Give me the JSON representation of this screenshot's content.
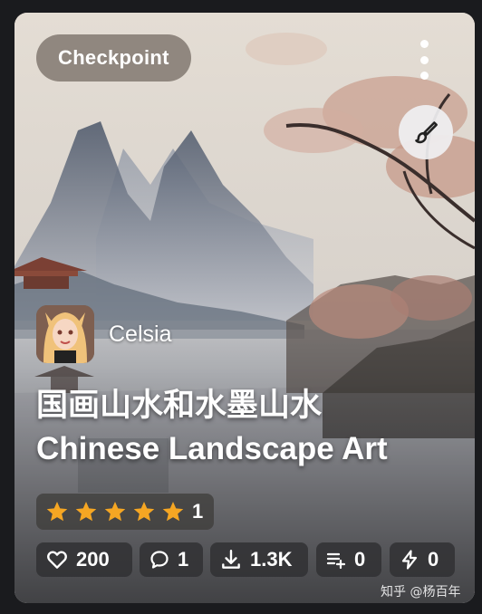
{
  "card": {
    "type_badge": "Checkpoint",
    "creator_name": "Celsia",
    "title_zh": "国画山水和水墨山水",
    "title_en": "Chinese Landscape Art",
    "rating": {
      "stars": 5,
      "count": "1"
    },
    "stats": {
      "likes": "200",
      "comments": "1",
      "downloads": "1.3K",
      "collections": "0",
      "tips": "0"
    }
  },
  "watermark": "知乎 @杨百年",
  "icons": [
    "menu-dots-icon",
    "brush-icon",
    "star-icon",
    "heart-icon",
    "comment-icon",
    "download-icon",
    "playlist-add-icon",
    "bolt-icon"
  ],
  "colors": {
    "star": "#f5a623",
    "badge_bg": "#7a7068",
    "chip_bg": "#303032"
  }
}
